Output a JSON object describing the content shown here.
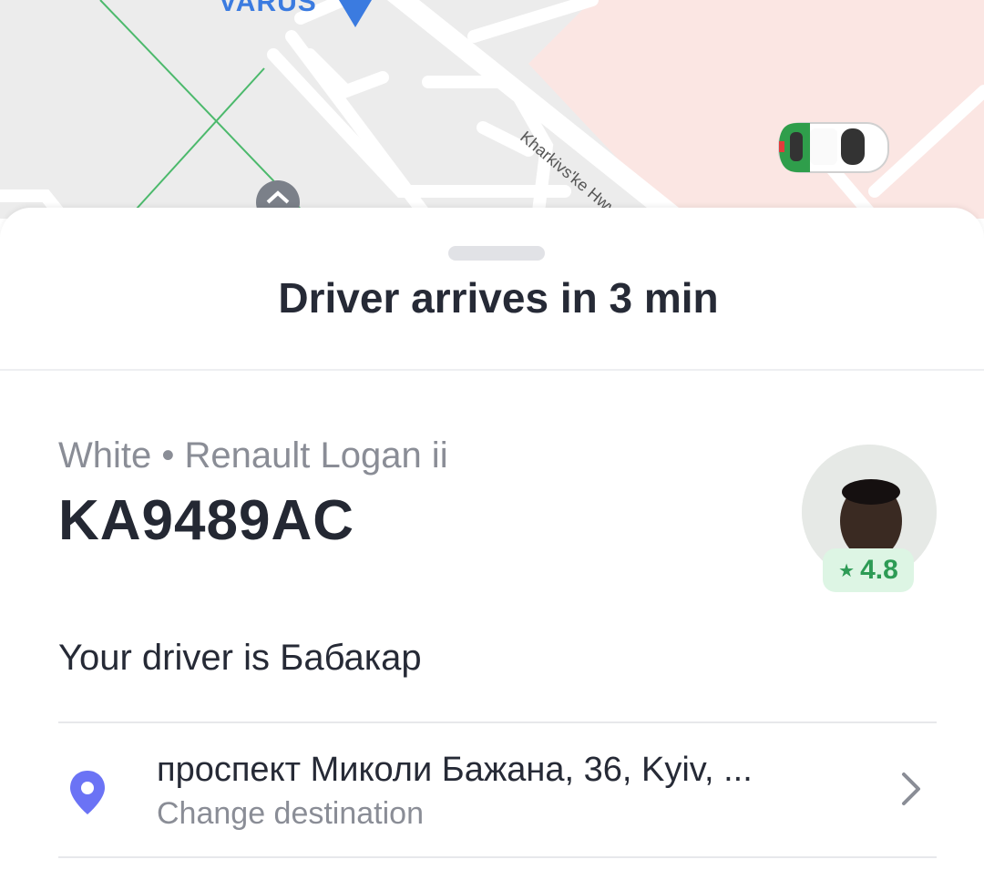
{
  "map": {
    "poi_label": "VARUS",
    "street_label": "Kharkivs'ke Hwy"
  },
  "sheet": {
    "title": "Driver arrives in 3 min",
    "car_description": "White • Renault Logan ii",
    "plate": "KA9489AC",
    "rating": "4.8",
    "driver_text": "Your driver is Бабакар",
    "destination": {
      "address": "проспект Миколи Бажана, 36, Kyiv, ...",
      "action": "Change destination"
    }
  },
  "colors": {
    "accent_pin": "#6b73f5",
    "rating_green": "#2d9b55",
    "poi_blue": "#3b7be0"
  },
  "icons": [
    "location-pin-icon",
    "chevron-right-icon",
    "star-icon",
    "car-icon",
    "map-pin-icon",
    "transit-icon"
  ]
}
